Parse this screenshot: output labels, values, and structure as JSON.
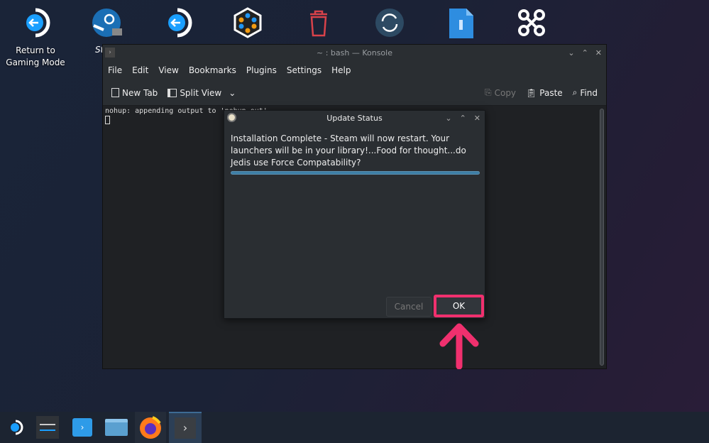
{
  "desktop": {
    "icons": [
      {
        "name": "return-to-gaming-mode",
        "label": "Return to\nGaming Mode"
      },
      {
        "name": "steam",
        "label": "St"
      },
      {
        "name": "return-arrow"
      },
      {
        "name": "hexagon-app"
      },
      {
        "name": "trash"
      },
      {
        "name": "sync"
      },
      {
        "name": "file"
      },
      {
        "name": "drone"
      }
    ],
    "return_label_1": "Return to",
    "return_label_2": "Gaming Mode",
    "steam_label_partial": "St"
  },
  "konsole": {
    "title": "~ : bash — Konsole",
    "menu": [
      "File",
      "Edit",
      "View",
      "Bookmarks",
      "Plugins",
      "Settings",
      "Help"
    ],
    "toolbar": {
      "new_tab": "New Tab",
      "split_view": "Split View",
      "copy": "Copy",
      "paste": "Paste",
      "find": "Find"
    },
    "terminal_line": "nohup: appending output to 'nohup.out'"
  },
  "dialog": {
    "title": "Update Status",
    "message": "Installation Complete - Steam will now restart. Your launchers will be in your library!...Food for thought...do Jedis use Force Compatability?",
    "progress_percent": 100,
    "cancel": "Cancel",
    "ok": "OK"
  },
  "colors": {
    "highlight": "#f0306e",
    "progress": "#3d7ea6"
  }
}
